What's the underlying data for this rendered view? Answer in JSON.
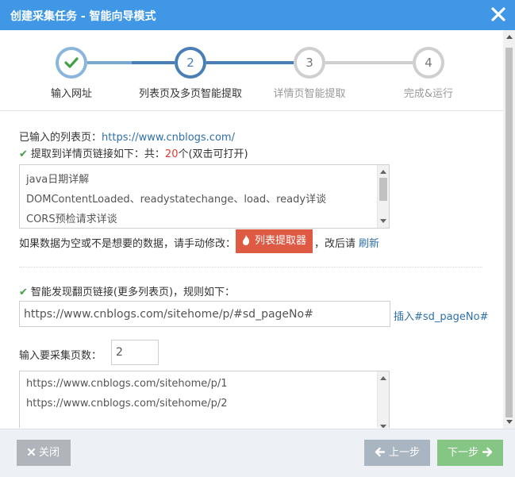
{
  "window": {
    "title": "创建采集任务 - 智能向导模式",
    "close_icon": "close-icon"
  },
  "colors": {
    "titlebar": "#3f97e5",
    "step_done": "#43a047",
    "step_active": "#4a7fb5",
    "step_pending": "#c8c8c8",
    "link": "#2e6fa9",
    "danger": "#de5a45",
    "next_button": "#85c685"
  },
  "wizard": {
    "steps": [
      {
        "label": "输入网址",
        "number": "",
        "state": "done",
        "icon": "checkmark-icon"
      },
      {
        "label": "列表页及多页智能提取",
        "number": "2",
        "state": "active"
      },
      {
        "label": "详情页智能提取",
        "number": "3",
        "state": "pending"
      },
      {
        "label": "完成&运行",
        "number": "4",
        "state": "pending"
      }
    ]
  },
  "list_page": {
    "prefix": "已输入的列表页：",
    "url": "https://www.cnblogs.com/"
  },
  "extract": {
    "prefix": "提取到详情页链接如下：共：",
    "count": "20",
    "suffix": "个(双击可打开)",
    "icon": "checkmark-icon",
    "items": [
      "java日期详解",
      "DOMContentLoaded、readystatechange、load、ready详谈",
      "CORS预检请求详谈"
    ]
  },
  "manual": {
    "text": "如果数据为空或不是想要的数据，请手动修改：",
    "button_label": "列表提取器",
    "button_icon": "pointer-icon",
    "after": "，改后请",
    "refresh": "刷新"
  },
  "paging": {
    "title": "智能发现翻页链接(更多列表页)，规则如下：",
    "icon": "checkmark-icon",
    "rule_value": "https://www.cnblogs.com/sitehome/p/#sd_pageNo#",
    "insert_link": "插入#sd_pageNo#"
  },
  "pages": {
    "label": "输入要采集页数：",
    "value": "2",
    "urls": [
      "https://www.cnblogs.com/sitehome/p/1",
      "https://www.cnblogs.com/sitehome/p/2"
    ]
  },
  "footer": {
    "close_label": "关闭",
    "close_icon": "x-icon",
    "prev_label": "上一步",
    "prev_icon": "arrow-left-icon",
    "next_label": "下一步",
    "next_icon": "arrow-right-icon"
  }
}
